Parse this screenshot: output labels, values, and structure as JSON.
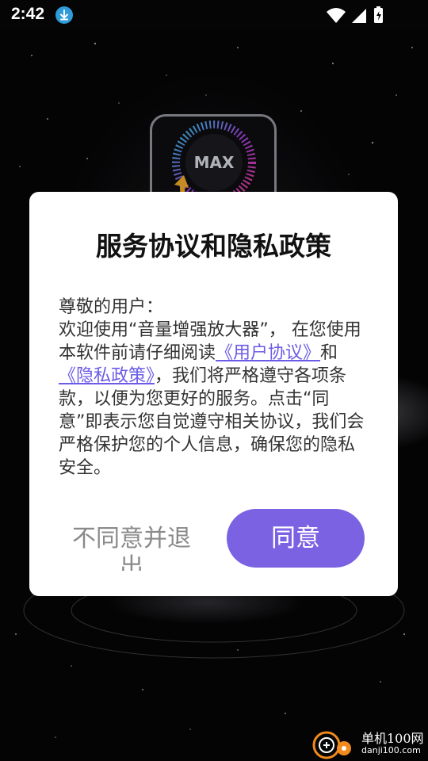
{
  "status_bar": {
    "time": "2:42",
    "icons": [
      "download-icon",
      "wifi-icon",
      "signal-icon",
      "battery-icon"
    ]
  },
  "app": {
    "icon_text": "MAX"
  },
  "dialog": {
    "title": "服务协议和隐私政策",
    "greeting": "尊敬的用户：",
    "text_1": "欢迎使用“音量增强放大器”， 在您使用本软件前请仔细阅读",
    "user_agreement_link": "《用户协议》",
    "text_2": "和",
    "privacy_policy_link": "《隐私政策》",
    "text_3": "，我们将严格遵守各项条款，以便为您更好的服务。点击“同意”即表示您自觉遵守相关协议，我们会严格保护您的个人信息，确保您的隐私安全。",
    "disagree_label": "不同意并退出",
    "agree_label": "同意"
  },
  "watermark": {
    "name": "单机100网",
    "url": "danji100.com"
  },
  "colors": {
    "accent": "#7b62e3",
    "link": "#6b5ce7",
    "dialog_bg": "#ffffff"
  }
}
